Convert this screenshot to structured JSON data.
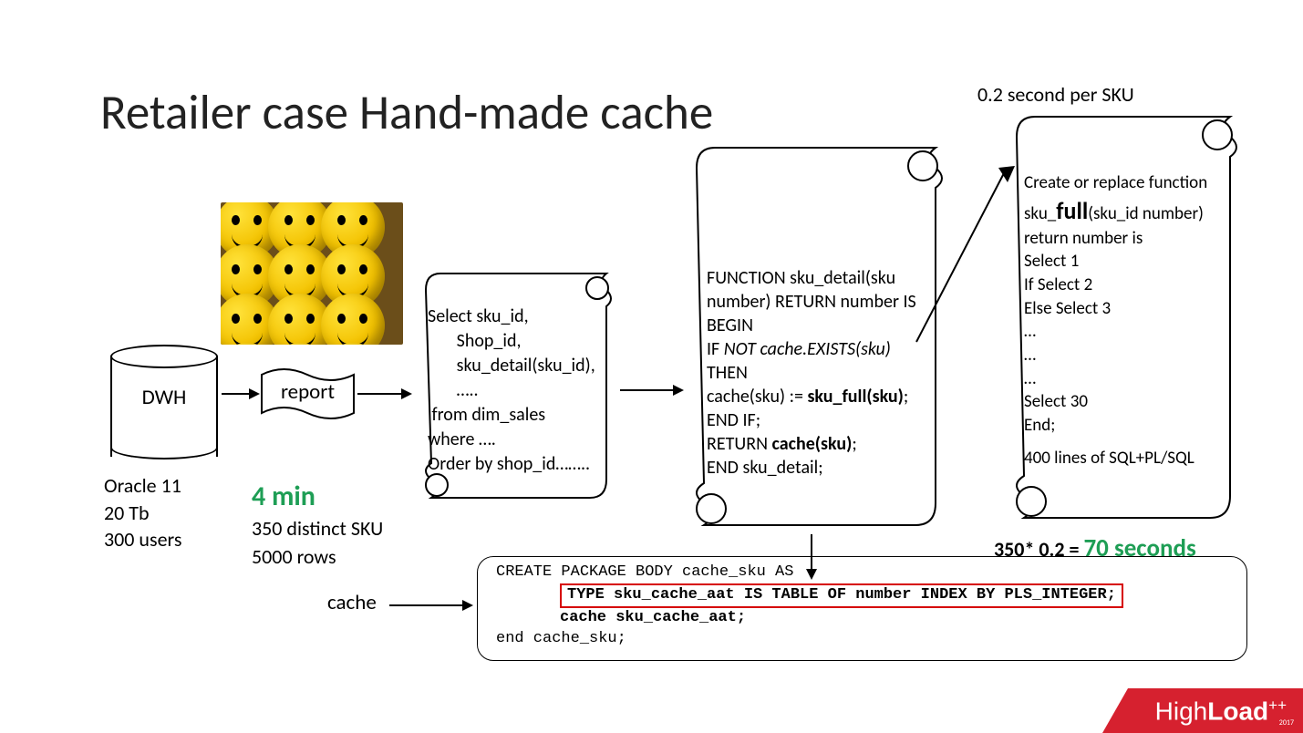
{
  "title": "Retailer case Hand-made cache",
  "db": {
    "label": "DWH",
    "info_line1": "Oracle 11",
    "info_line2": "20 Tb",
    "info_line3": "300 users"
  },
  "report_label": "report",
  "timing": {
    "highlight": "4 min",
    "line2": "350 distinct SKU",
    "line3": "5000 rows"
  },
  "scroll1": "Select sku_id,\n       Shop_id,\n       sku_detail(sku_id),\n       …..\n from dim_sales\nwhere ….\nOrder by shop_id……..",
  "scroll2": {
    "l1": "FUNCTION sku_detail(sku number) RETURN number IS",
    "l2": "BEGIN",
    "l3a": "  IF ",
    "l3b": "NOT cache.EXISTS(sku)",
    "l3c": " THEN",
    "l4a": "     cache(sku) := ",
    "l4b": "sku_full(sku)",
    "l4c": ";",
    "l5": "  END IF;",
    "l6a": "  RETURN ",
    "l6b": "cache(sku)",
    "l6c": ";",
    "l7": "END sku_detail;"
  },
  "scroll3_header": "0.2 second per SKU",
  "scroll3": {
    "l1": "Create or replace function",
    "l2a": "sku_",
    "l2b": "full",
    "l2c": "(sku_id number)",
    "l3": "return number is",
    "l4": "Select 1",
    "l5": "If Select 2",
    "l6": "Else Select 3",
    "l7": "…",
    "l8": "…",
    "l9": "…",
    "l10": "Select 30",
    "l11": "End;",
    "l12": "400 lines of SQL+PL/SQL"
  },
  "calc": {
    "prefix": "350* 0.2 = ",
    "result": "70 seconds"
  },
  "cache_label": "cache",
  "cache_code": {
    "l1": "CREATE PACKAGE BODY cache_sku AS",
    "l2_hl": "TYPE sku_cache_aat IS TABLE OF number INDEX BY PLS_INTEGER;",
    "l3": "cache sku_cache_aat;",
    "l4": "end cache_sku;"
  },
  "logo": {
    "thin": "High",
    "bold": "Load",
    "plus": "++",
    "year": "2017"
  }
}
